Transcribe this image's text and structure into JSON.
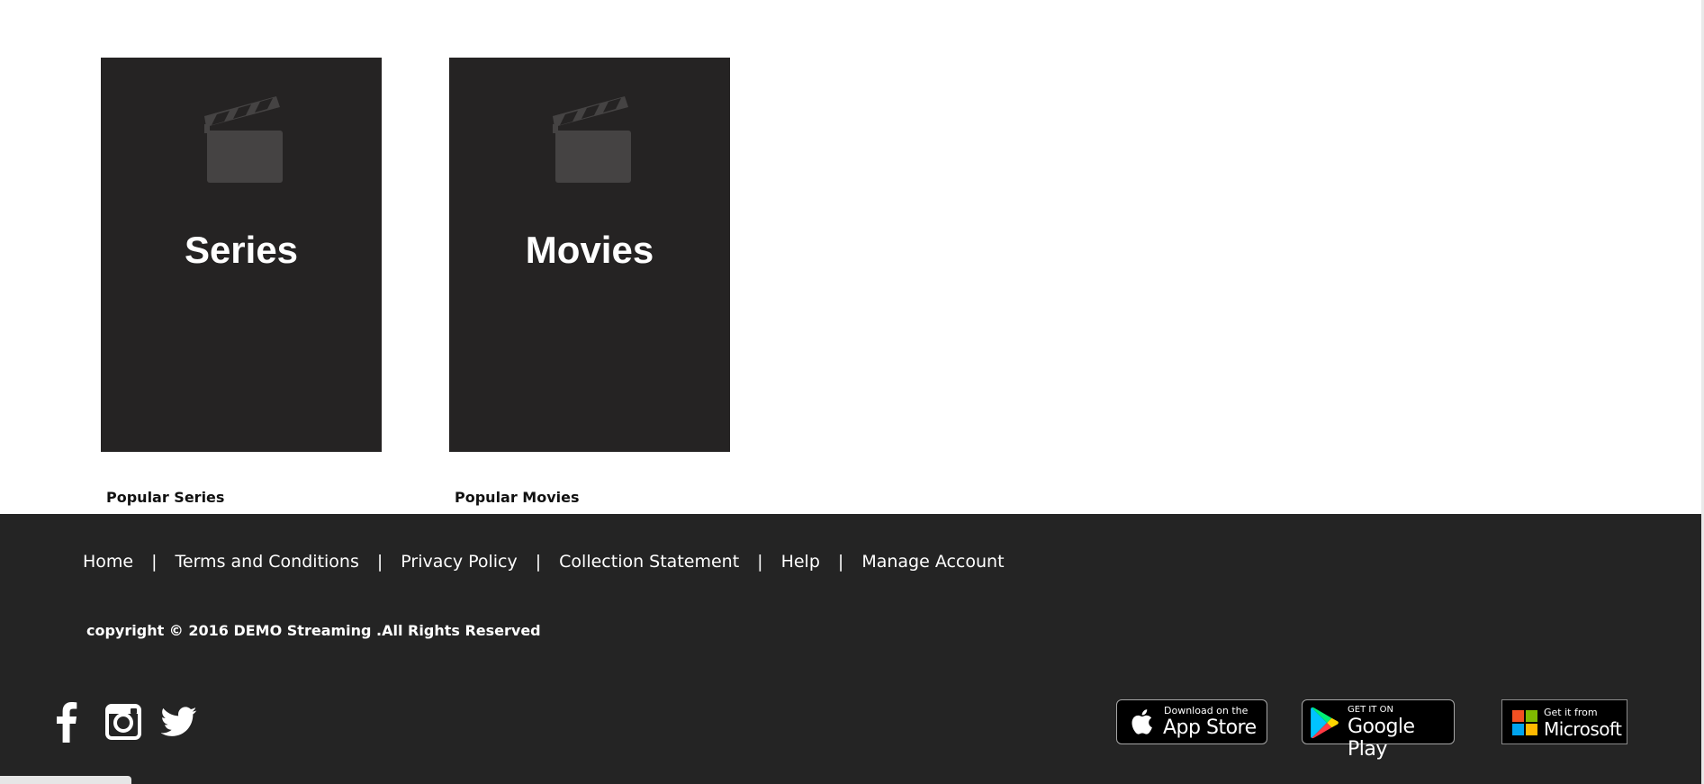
{
  "tiles": [
    {
      "title": "Series",
      "caption": "Popular Series"
    },
    {
      "title": "Movies",
      "caption": "Popular Movies"
    }
  ],
  "footer": {
    "links": [
      "Home",
      "Terms and Conditions",
      "Privacy Policy",
      "Collection Statement",
      "Help",
      "Manage Account"
    ],
    "separator": "|",
    "copyright": "copyright © 2016 DEMO Streaming .All Rights Reserved",
    "social_icons": [
      "facebook-icon",
      "instagram-icon",
      "twitter-icon"
    ],
    "store_badges": {
      "app_store": {
        "small": "Download on the",
        "big": "App Store"
      },
      "google_play": {
        "small": "GET IT ON",
        "big": "Google Play"
      },
      "microsoft": {
        "small": "Get it from",
        "big": "Microsoft"
      }
    }
  },
  "colors": {
    "tile_bg": "#252323",
    "footer_bg": "#242424",
    "placeholder_icon": "#454343"
  }
}
